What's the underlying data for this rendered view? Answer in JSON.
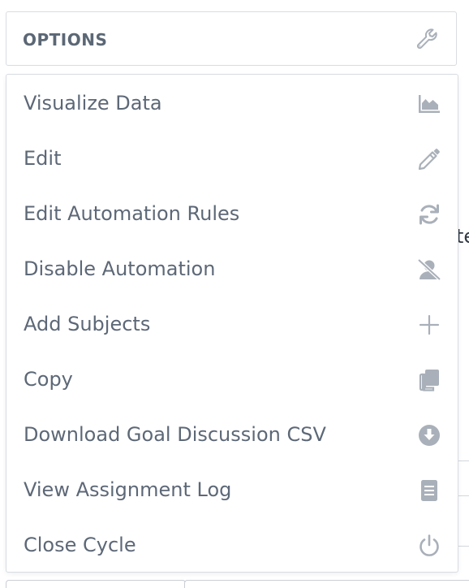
{
  "options": {
    "title": "OPTIONS",
    "icon": "wrench-icon"
  },
  "menu": {
    "items": [
      {
        "label": "Visualize Data",
        "icon": "area-chart-icon"
      },
      {
        "label": "Edit",
        "icon": "pencil-icon"
      },
      {
        "label": "Edit Automation Rules",
        "icon": "refresh-icon"
      },
      {
        "label": "Disable Automation",
        "icon": "user-slash-icon"
      },
      {
        "label": "Add Subjects",
        "icon": "plus-icon"
      },
      {
        "label": "Copy",
        "icon": "copy-icon"
      },
      {
        "label": "Download Goal Discussion CSV",
        "icon": "download-circle-icon"
      },
      {
        "label": "View Assignment Log",
        "icon": "document-icon"
      },
      {
        "label": "Close Cycle",
        "icon": "power-icon"
      }
    ]
  },
  "background": {
    "partial_text": "te"
  },
  "colors": {
    "label": "#5d6877",
    "icon": "#a9b0b9",
    "border": "#d8dce1"
  }
}
